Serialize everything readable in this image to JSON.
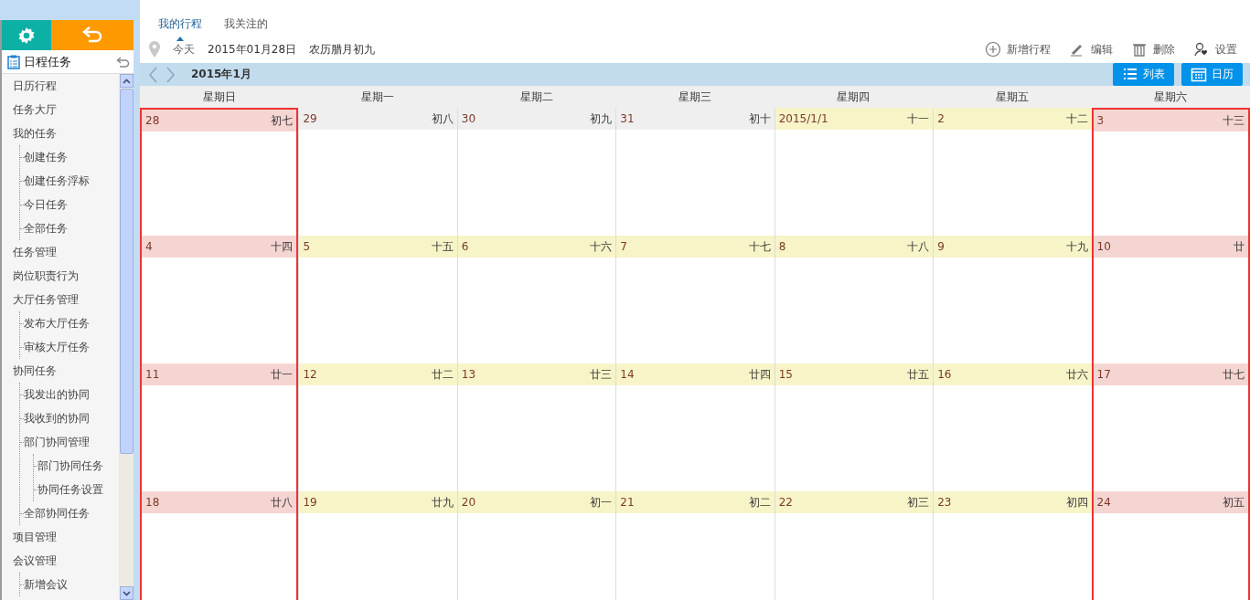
{
  "sidebar": {
    "title": "日程任务",
    "items": [
      {
        "label": "日历行程"
      },
      {
        "label": "任务大厅"
      },
      {
        "label": "我的任务",
        "children": [
          {
            "label": "创建任务"
          },
          {
            "label": "创建任务浮标"
          },
          {
            "label": "今日任务"
          },
          {
            "label": "全部任务"
          }
        ]
      },
      {
        "label": "任务管理"
      },
      {
        "label": "岗位职责行为"
      },
      {
        "label": "大厅任务管理",
        "children": [
          {
            "label": "发布大厅任务"
          },
          {
            "label": "审核大厅任务"
          }
        ]
      },
      {
        "label": "协同任务",
        "children": [
          {
            "label": "我发出的协同"
          },
          {
            "label": "我收到的协同"
          },
          {
            "label": "部门协同管理",
            "children": [
              {
                "label": "部门协同任务"
              },
              {
                "label": "协同任务设置"
              }
            ]
          },
          {
            "label": "全部协同任务"
          }
        ]
      },
      {
        "label": "项目管理"
      },
      {
        "label": "会议管理",
        "children": [
          {
            "label": "新增会议"
          }
        ]
      }
    ]
  },
  "tabs": [
    {
      "label": "我的行程",
      "selected": true
    },
    {
      "label": "我关注的",
      "selected": false
    }
  ],
  "today": {
    "label": "今天",
    "date": "2015年01月28日",
    "lunar": "农历腊月初九"
  },
  "actions": [
    {
      "kind": "add",
      "label": "新增行程"
    },
    {
      "kind": "edit",
      "label": "编辑"
    },
    {
      "kind": "delete",
      "label": "删除"
    },
    {
      "kind": "settings",
      "label": "设置"
    }
  ],
  "month": "2015年1月",
  "views": [
    {
      "kind": "list",
      "label": "列表"
    },
    {
      "kind": "calendar",
      "label": "日历"
    }
  ],
  "weekdays": [
    "星期日",
    "星期一",
    "星期二",
    "星期三",
    "星期四",
    "星期五",
    "星期六"
  ],
  "weeks": [
    [
      {
        "day": "28",
        "lunar": "初七",
        "kind": "weekend"
      },
      {
        "day": "29",
        "lunar": "初八",
        "kind": "other"
      },
      {
        "day": "30",
        "lunar": "初九",
        "kind": "other"
      },
      {
        "day": "31",
        "lunar": "初十",
        "kind": "other"
      },
      {
        "day": "2015/1/1",
        "lunar": "十一",
        "kind": "current"
      },
      {
        "day": "2",
        "lunar": "十二",
        "kind": "current"
      },
      {
        "day": "3",
        "lunar": "十三",
        "kind": "weekend"
      }
    ],
    [
      {
        "day": "4",
        "lunar": "十四",
        "kind": "weekend"
      },
      {
        "day": "5",
        "lunar": "十五",
        "kind": "current"
      },
      {
        "day": "6",
        "lunar": "十六",
        "kind": "current"
      },
      {
        "day": "7",
        "lunar": "十七",
        "kind": "current"
      },
      {
        "day": "8",
        "lunar": "十八",
        "kind": "current"
      },
      {
        "day": "9",
        "lunar": "十九",
        "kind": "current"
      },
      {
        "day": "10",
        "lunar": "廿",
        "kind": "weekend"
      }
    ],
    [
      {
        "day": "11",
        "lunar": "廿一",
        "kind": "weekend"
      },
      {
        "day": "12",
        "lunar": "廿二",
        "kind": "current"
      },
      {
        "day": "13",
        "lunar": "廿三",
        "kind": "current"
      },
      {
        "day": "14",
        "lunar": "廿四",
        "kind": "current"
      },
      {
        "day": "15",
        "lunar": "廿五",
        "kind": "current"
      },
      {
        "day": "16",
        "lunar": "廿六",
        "kind": "current"
      },
      {
        "day": "17",
        "lunar": "廿七",
        "kind": "weekend"
      }
    ],
    [
      {
        "day": "18",
        "lunar": "廿八",
        "kind": "weekend"
      },
      {
        "day": "19",
        "lunar": "廿九",
        "kind": "current"
      },
      {
        "day": "20",
        "lunar": "初一",
        "kind": "current"
      },
      {
        "day": "21",
        "lunar": "初二",
        "kind": "current"
      },
      {
        "day": "22",
        "lunar": "初三",
        "kind": "current"
      },
      {
        "day": "23",
        "lunar": "初四",
        "kind": "current"
      },
      {
        "day": "24",
        "lunar": "初五",
        "kind": "weekend"
      }
    ]
  ]
}
